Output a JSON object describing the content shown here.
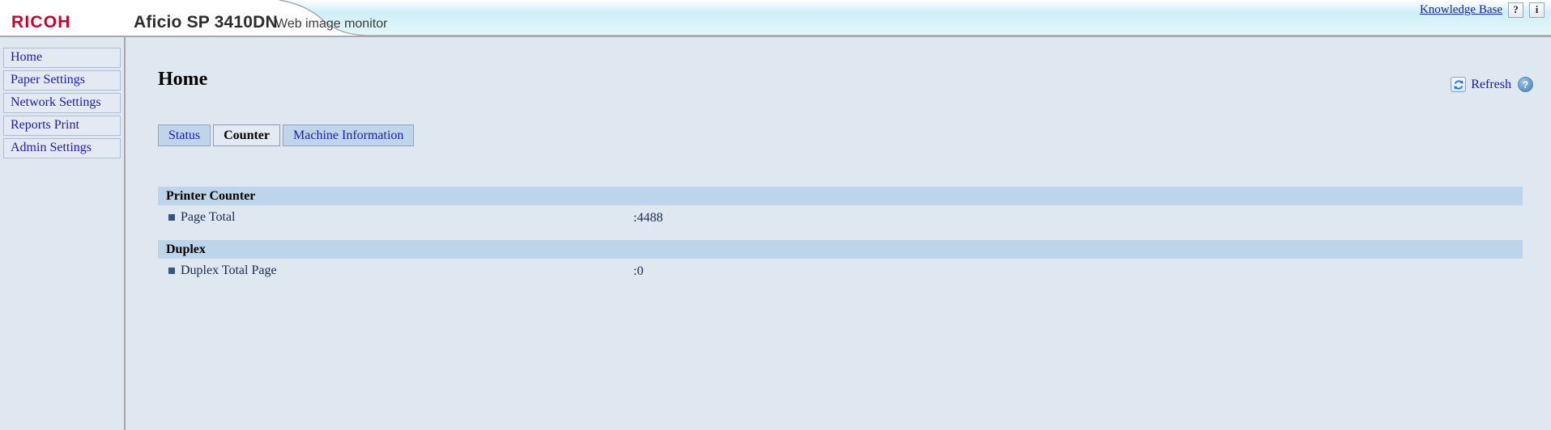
{
  "header": {
    "brand": "RICOH",
    "model": "Aficio SP 3410DN",
    "subtitle": "Web image monitor",
    "knowledge_base_label": "Knowledge Base",
    "help_button_label": "?",
    "info_button_label": "i"
  },
  "sidebar": {
    "items": [
      {
        "label": "Home"
      },
      {
        "label": "Paper Settings"
      },
      {
        "label": "Network Settings"
      },
      {
        "label": "Reports Print"
      },
      {
        "label": "Admin Settings"
      }
    ]
  },
  "main": {
    "page_title": "Home",
    "refresh_label": "Refresh",
    "help_icon_label": "?",
    "tabs": [
      {
        "label": "Status",
        "active": false
      },
      {
        "label": "Counter",
        "active": true
      },
      {
        "label": "Machine Information",
        "active": false
      }
    ],
    "sections": [
      {
        "title": "Printer Counter",
        "rows": [
          {
            "label": "Page Total",
            "value": ":4488"
          }
        ]
      },
      {
        "title": "Duplex",
        "rows": [
          {
            "label": "Duplex Total Page",
            "value": ":0"
          }
        ]
      }
    ]
  },
  "colors": {
    "brand_red": "#c8012e",
    "link_blue": "#1a1ab0",
    "page_bg": "#dfe7f1",
    "section_header_bg": "#bdd5ea",
    "tab_inactive_bg": "#bfd6ea",
    "header_curve_cyan": "#cdeef5"
  }
}
